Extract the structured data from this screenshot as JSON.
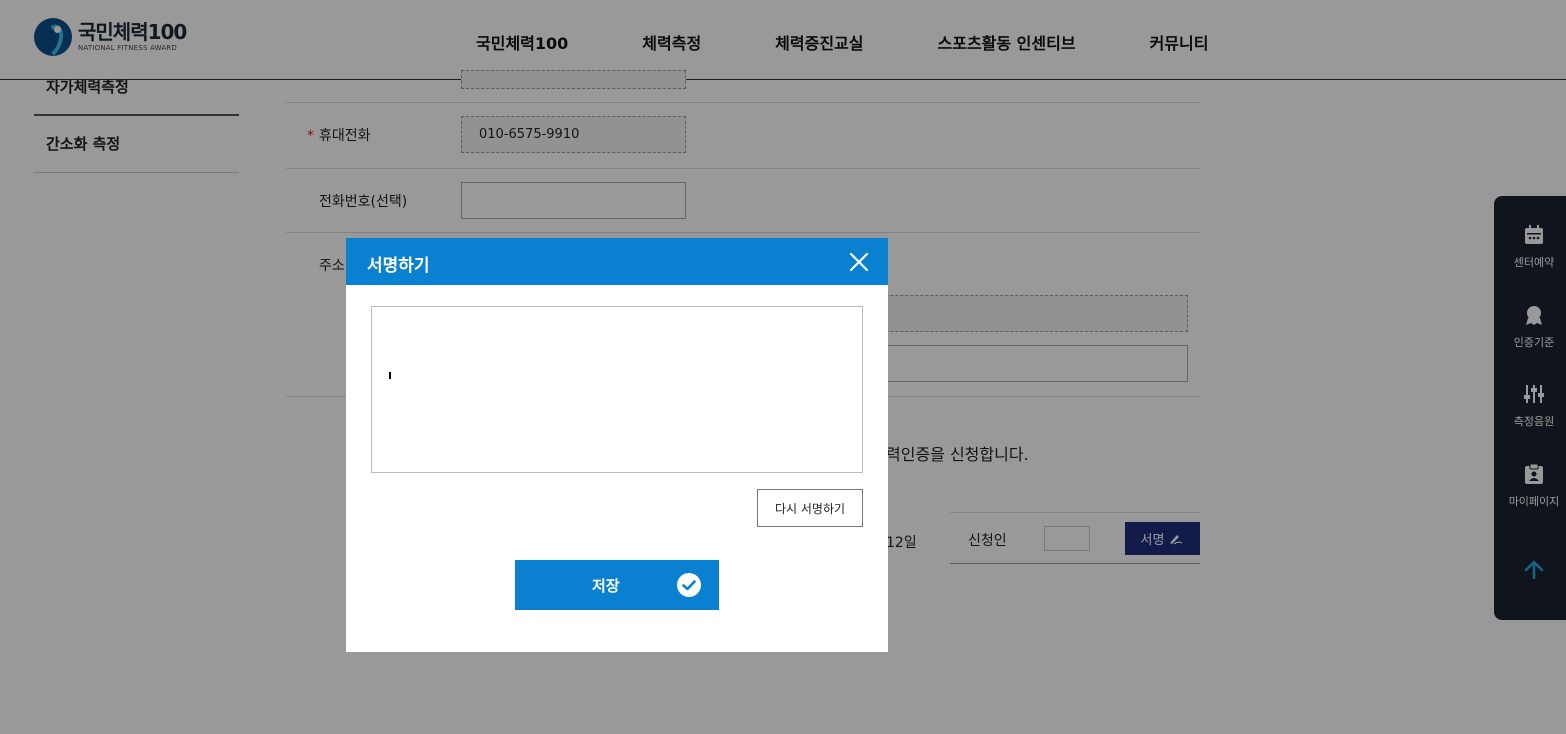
{
  "header": {
    "logo_title": "국민체력100",
    "logo_sub": "NATIONAL FITNESS AWARD",
    "nav": [
      "국민체력100",
      "체력측정",
      "체력증진교실",
      "스포츠활동 인센티브",
      "커뮤니티"
    ]
  },
  "lnb": {
    "items": [
      "자가체력측정",
      "간소화 측정"
    ]
  },
  "form": {
    "mobile_label": "휴대전화",
    "required_mark": "*",
    "mobile_value": "010-6575-9910",
    "phone_label": "전화번호(선택)",
    "phone_value": "",
    "address_label": "주소(",
    "notice_tail": "력인증을 신청합니다.",
    "date_tail": "12일",
    "applicant_label": "신청인",
    "sign_button": "서명"
  },
  "quick_menu": {
    "items": [
      "센터예약",
      "인증기준",
      "측정음원",
      "마이페이지"
    ]
  },
  "modal": {
    "title": "서명하기",
    "resign_button": "다시 서명하기",
    "save_button": "저장"
  },
  "colors": {
    "primary": "#0980d0",
    "sign_button": "#1f2d7a",
    "quick_bg": "#1b2230",
    "required": "#d22222"
  }
}
